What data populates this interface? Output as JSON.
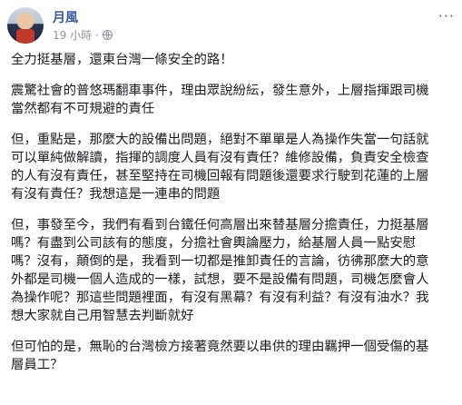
{
  "post": {
    "author": "月風",
    "time": "19 小時",
    "separator": "·",
    "more_label": "···",
    "paragraphs": [
      "全力挺基層，還東台灣一條安全的路！",
      "震驚社會的普悠瑪翻車事件，理由眾說紛紜，發生意外，上層指揮跟司機\n當然都有不可規避的責任",
      "但，重點是，那麼大的設備出問題，絕對不單單是人為操作失當一句話就\n可以單純做解讀，指揮的調度人員有沒有責任？維修設備，負責安全檢查\n的人有沒有責任，甚至堅持在司機回報有問題後還要求行駛到花蓮的上層\n有沒有責任？我想這是一連串的問題",
      "但，事發至今，我們有看到台鐵任何高層出來替基層分擔責任，力挺基層\n嗎？有盡到公司該有的態度，分擔社會輿論壓力，給基層人員一點安慰\n嗎？沒有，顛倒的是，我看到一切都是推卸責任的言論，彷彿那麼大的意\n外都是司機一個人造成的一樣，試想，要不是設備有問題，司機怎麼會人\n為操作呢？那這些問題裡面，有沒有黑幕？有沒有利益？有沒有油水？我\n想大家就自己用智慧去判斷就好",
      "但可怕的是，無恥的台灣檢方接著竟然要以串供的理由羈押一個受傷的基\n層員工？"
    ]
  },
  "icons": {
    "avatar": "profile-photo",
    "privacy": "globe-icon",
    "menu": "more-options-icon"
  },
  "colors": {
    "author": "#385898",
    "meta": "#90949c",
    "text": "#1c1e21"
  }
}
